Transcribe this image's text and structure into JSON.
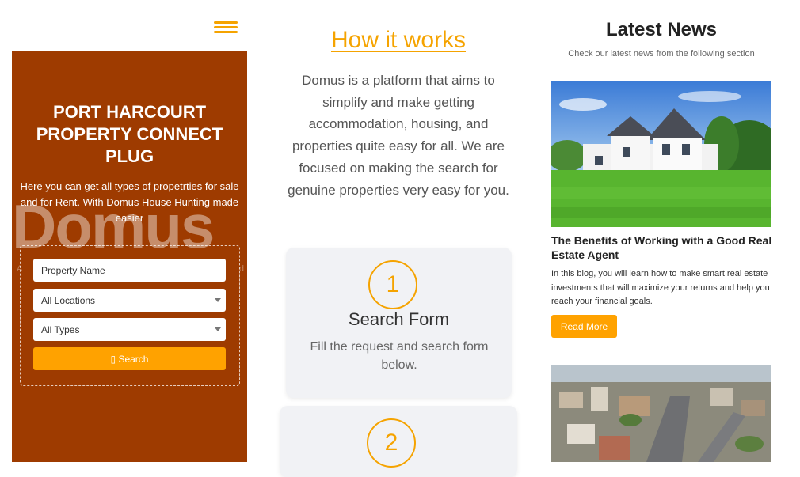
{
  "hero": {
    "title": "PORT HARCOURT PROPERTY CONNECT PLUG",
    "subtitle": "Here you can get all types of propetrties for sale and for Rent. With Domus House Hunting made easier",
    "logo_text": "Domus",
    "tagline_left": "A",
    "tagline_right": "d",
    "bg_color": "#9e3b00"
  },
  "search": {
    "property_placeholder": "Property Name",
    "location_value": "All Locations",
    "type_value": "All Types",
    "button_label": "▯ Search",
    "button_color": "#ffa200"
  },
  "how": {
    "title": "How it works",
    "description": "Domus is a platform that aims to simplify and make getting accommodation, housing, and properties quite easy for all. We are focused on making the search for genuine properties very easy for you.",
    "steps": [
      {
        "number": "1",
        "title": "Search Form",
        "description": "Fill the request and search form below."
      },
      {
        "number": "2"
      }
    ],
    "accent_color": "#f5a300"
  },
  "news": {
    "title": "Latest News",
    "subtitle": "Check our latest news from the following section",
    "articles": [
      {
        "title": "The Benefits of Working with a Good Real Estate Agent",
        "excerpt": "In this blog, you will learn how to make smart real estate investments that will maximize your returns and help you reach your financial goals.",
        "button_label": "Read More"
      }
    ]
  },
  "icons": [
    "hamburger-menu-icon",
    "search-icon",
    "chevron-down-icon"
  ]
}
